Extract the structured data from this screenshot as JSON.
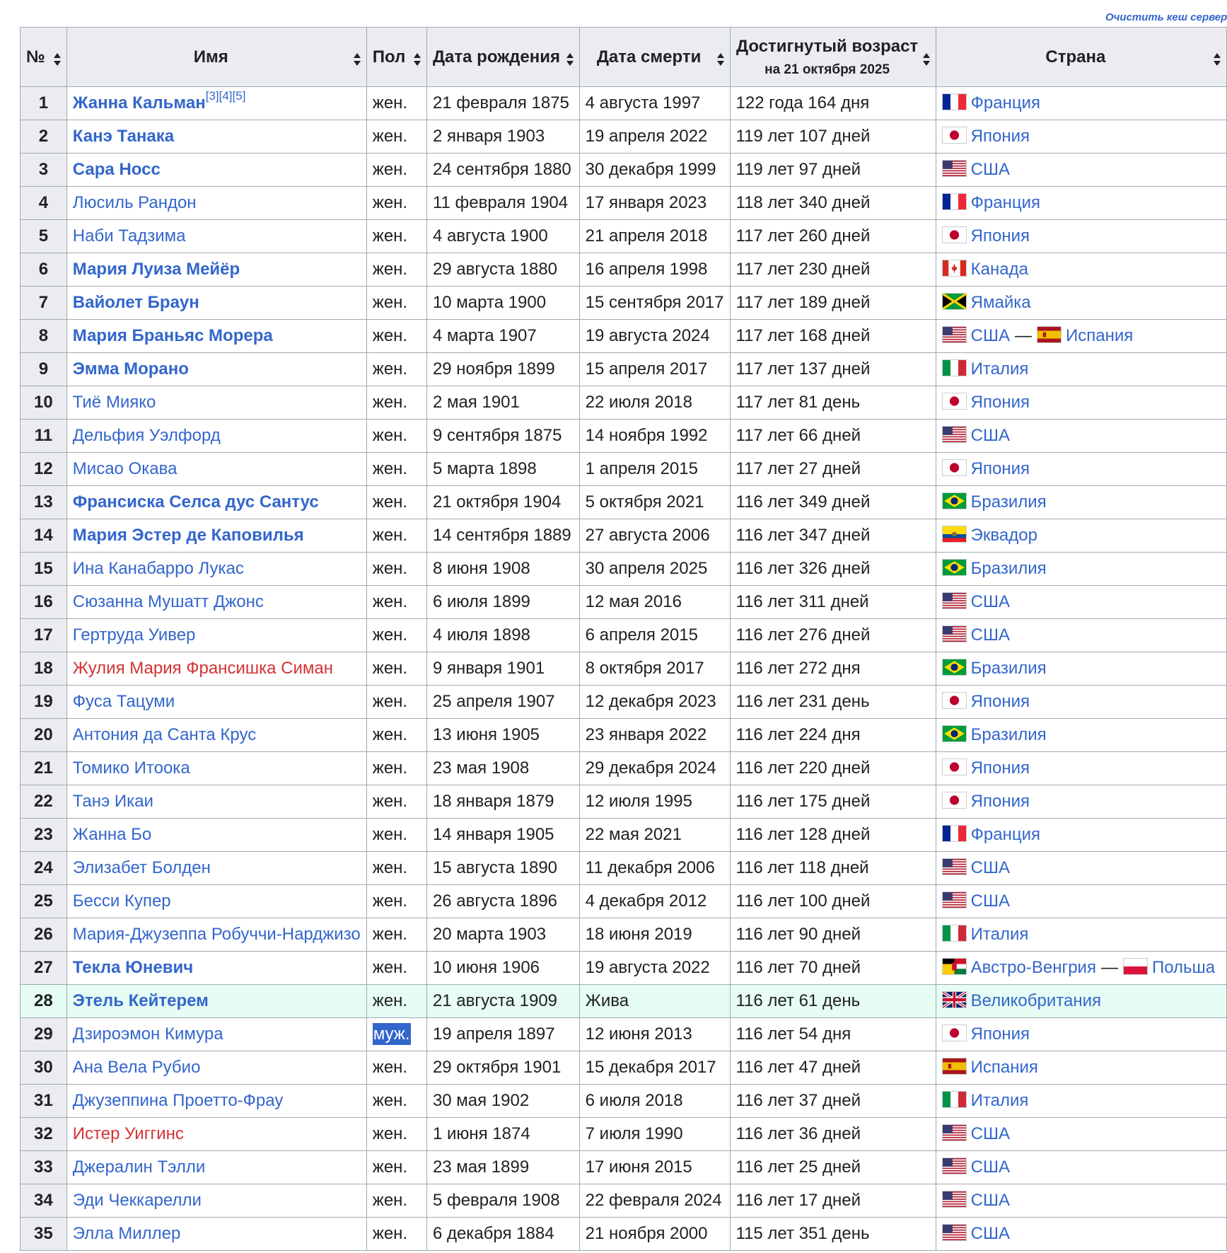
{
  "purge_link": "Очистить кеш сервера",
  "table": {
    "headers": {
      "num": "№",
      "name": "Имя",
      "sex": "Пол",
      "born": "Дата рождения",
      "died": "Дата смерти",
      "age": "Достигнутый возраст",
      "age_sub": "на 21 октября 2025",
      "country": "Страна"
    },
    "rows": [
      {
        "n": "1",
        "name": "Жанна Кальман",
        "refs": "[3][4][5]",
        "bold": true,
        "red": false,
        "sex": "жен.",
        "born": "21 февраля 1875",
        "died": "4 августа 1997",
        "age": "122 года 164 дня",
        "c": [
          {
            "flag": "fr",
            "name": "Франция"
          }
        ]
      },
      {
        "n": "2",
        "name": "Канэ Танака",
        "refs": "",
        "bold": true,
        "red": false,
        "sex": "жен.",
        "born": "2 января 1903",
        "died": "19 апреля 2022",
        "age": "119 лет 107 дней",
        "c": [
          {
            "flag": "jp",
            "name": "Япония"
          }
        ]
      },
      {
        "n": "3",
        "name": "Сара Носс",
        "refs": "",
        "bold": true,
        "red": false,
        "sex": "жен.",
        "born": "24 сентября 1880",
        "died": "30 декабря 1999",
        "age": "119 лет 97 дней",
        "c": [
          {
            "flag": "us",
            "name": "США"
          }
        ]
      },
      {
        "n": "4",
        "name": "Люсиль Рандон",
        "refs": "",
        "bold": false,
        "red": false,
        "sex": "жен.",
        "born": "11 февраля 1904",
        "died": "17 января 2023",
        "age": "118 лет 340 дней",
        "c": [
          {
            "flag": "fr",
            "name": "Франция"
          }
        ]
      },
      {
        "n": "5",
        "name": "Наби Тадзима",
        "refs": "",
        "bold": false,
        "red": false,
        "sex": "жен.",
        "born": "4 августа 1900",
        "died": "21 апреля 2018",
        "age": "117 лет 260 дней",
        "c": [
          {
            "flag": "jp",
            "name": "Япония"
          }
        ]
      },
      {
        "n": "6",
        "name": "Мария Луиза Мейёр",
        "refs": "",
        "bold": true,
        "red": false,
        "sex": "жен.",
        "born": "29 августа 1880",
        "died": "16 апреля 1998",
        "age": "117 лет 230 дней",
        "c": [
          {
            "flag": "ca",
            "name": "Канада"
          }
        ]
      },
      {
        "n": "7",
        "name": "Вайолет Браун",
        "refs": "",
        "bold": true,
        "red": false,
        "sex": "жен.",
        "born": "10 марта 1900",
        "died": "15 сентября 2017",
        "age": "117 лет 189 дней",
        "c": [
          {
            "flag": "jm",
            "name": "Ямайка"
          }
        ]
      },
      {
        "n": "8",
        "name": "Мария Браньяс Морера",
        "refs": "",
        "bold": true,
        "red": false,
        "sex": "жен.",
        "born": "4 марта 1907",
        "died": "19 августа 2024",
        "age": "117 лет 168 дней",
        "c": [
          {
            "flag": "us",
            "name": "США"
          },
          {
            "flag": "es",
            "name": "Испания"
          }
        ]
      },
      {
        "n": "9",
        "name": "Эмма Морано",
        "refs": "",
        "bold": true,
        "red": false,
        "sex": "жен.",
        "born": "29 ноября 1899",
        "died": "15 апреля 2017",
        "age": "117 лет 137 дней",
        "c": [
          {
            "flag": "it",
            "name": "Италия"
          }
        ]
      },
      {
        "n": "10",
        "name": "Тиё Мияко",
        "refs": "",
        "bold": false,
        "red": false,
        "sex": "жен.",
        "born": "2 мая 1901",
        "died": "22 июля 2018",
        "age": "117 лет 81 день",
        "c": [
          {
            "flag": "jp",
            "name": "Япония"
          }
        ]
      },
      {
        "n": "11",
        "name": "Дельфия Уэлфорд",
        "refs": "",
        "bold": false,
        "red": false,
        "sex": "жен.",
        "born": "9 сентября 1875",
        "died": "14 ноября 1992",
        "age": "117 лет 66 дней",
        "c": [
          {
            "flag": "us",
            "name": "США"
          }
        ]
      },
      {
        "n": "12",
        "name": "Мисао Окава",
        "refs": "",
        "bold": false,
        "red": false,
        "sex": "жен.",
        "born": "5 марта 1898",
        "died": "1 апреля 2015",
        "age": "117 лет 27 дней",
        "c": [
          {
            "flag": "jp",
            "name": "Япония"
          }
        ]
      },
      {
        "n": "13",
        "name": "Франсиска Селса дус Сантус",
        "refs": "",
        "bold": true,
        "red": false,
        "sex": "жен.",
        "born": "21 октября 1904",
        "died": "5 октября 2021",
        "age": "116 лет 349 дней",
        "c": [
          {
            "flag": "br",
            "name": "Бразилия"
          }
        ]
      },
      {
        "n": "14",
        "name": "Мария Эстер де Каповилья",
        "refs": "",
        "bold": true,
        "red": false,
        "sex": "жен.",
        "born": "14 сентября 1889",
        "died": "27 августа 2006",
        "age": "116 лет 347 дней",
        "c": [
          {
            "flag": "ec",
            "name": "Эквадор"
          }
        ]
      },
      {
        "n": "15",
        "name": "Ина Канабарро Лукас",
        "refs": "",
        "bold": false,
        "red": false,
        "sex": "жен.",
        "born": "8 июня 1908",
        "died": "30 апреля 2025",
        "age": "116 лет 326 дней",
        "c": [
          {
            "flag": "br",
            "name": "Бразилия"
          }
        ]
      },
      {
        "n": "16",
        "name": "Сюзанна Мушатт Джонс",
        "refs": "",
        "bold": false,
        "red": false,
        "sex": "жен.",
        "born": "6 июля 1899",
        "died": "12 мая 2016",
        "age": "116 лет 311 дней",
        "c": [
          {
            "flag": "us",
            "name": "США"
          }
        ]
      },
      {
        "n": "17",
        "name": "Гертруда Уивер",
        "refs": "",
        "bold": false,
        "red": false,
        "sex": "жен.",
        "born": "4 июля 1898",
        "died": "6 апреля 2015",
        "age": "116 лет 276 дней",
        "c": [
          {
            "flag": "us",
            "name": "США"
          }
        ]
      },
      {
        "n": "18",
        "name": "Жулия Мария Франсишка Симан",
        "refs": "",
        "bold": false,
        "red": true,
        "sex": "жен.",
        "born": "9 января 1901",
        "died": "8 октября 2017",
        "age": "116 лет 272 дня",
        "c": [
          {
            "flag": "br",
            "name": "Бразилия"
          }
        ]
      },
      {
        "n": "19",
        "name": "Фуса Тацуми",
        "refs": "",
        "bold": false,
        "red": false,
        "sex": "жен.",
        "born": "25 апреля 1907",
        "died": "12 декабря 2023",
        "age": "116 лет 231 день",
        "c": [
          {
            "flag": "jp",
            "name": "Япония"
          }
        ]
      },
      {
        "n": "20",
        "name": "Антония да Санта Крус",
        "refs": "",
        "bold": false,
        "red": false,
        "sex": "жен.",
        "born": "13 июня 1905",
        "died": "23 января 2022",
        "age": "116 лет 224 дня",
        "c": [
          {
            "flag": "br",
            "name": "Бразилия"
          }
        ]
      },
      {
        "n": "21",
        "name": "Томико Итоока",
        "refs": "",
        "bold": false,
        "red": false,
        "sex": "жен.",
        "born": "23 мая 1908",
        "died": "29 декабря 2024",
        "age": "116 лет 220 дней",
        "c": [
          {
            "flag": "jp",
            "name": "Япония"
          }
        ]
      },
      {
        "n": "22",
        "name": "Танэ Икаи",
        "refs": "",
        "bold": false,
        "red": false,
        "sex": "жен.",
        "born": "18 января 1879",
        "died": "12 июля 1995",
        "age": "116 лет 175 дней",
        "c": [
          {
            "flag": "jp",
            "name": "Япония"
          }
        ]
      },
      {
        "n": "23",
        "name": "Жанна Бо",
        "refs": "",
        "bold": false,
        "red": false,
        "sex": "жен.",
        "born": "14 января 1905",
        "died": "22 мая 2021",
        "age": "116 лет 128 дней",
        "c": [
          {
            "flag": "fr",
            "name": "Франция"
          }
        ]
      },
      {
        "n": "24",
        "name": "Элизабет Болден",
        "refs": "",
        "bold": false,
        "red": false,
        "sex": "жен.",
        "born": "15 августа 1890",
        "died": "11 декабря 2006",
        "age": "116 лет 118 дней",
        "c": [
          {
            "flag": "us",
            "name": "США"
          }
        ]
      },
      {
        "n": "25",
        "name": "Бесси Купер",
        "refs": "",
        "bold": false,
        "red": false,
        "sex": "жен.",
        "born": "26 августа 1896",
        "died": "4 декабря 2012",
        "age": "116 лет 100 дней",
        "c": [
          {
            "flag": "us",
            "name": "США"
          }
        ]
      },
      {
        "n": "26",
        "name": "Мария-Джузеппа Робуччи-Нарджизо",
        "refs": "",
        "bold": false,
        "red": false,
        "sex": "жен.",
        "born": "20 марта 1903",
        "died": "18 июня 2019",
        "age": "116 лет 90 дней",
        "c": [
          {
            "flag": "it",
            "name": "Италия"
          }
        ]
      },
      {
        "n": "27",
        "name": "Текла Юневич",
        "refs": "",
        "bold": true,
        "red": false,
        "sex": "жен.",
        "born": "10 июня 1906",
        "died": "19 августа 2022",
        "age": "116 лет 70 дней",
        "c": [
          {
            "flag": "ah",
            "name": "Австро-Венгрия"
          },
          {
            "flag": "pl",
            "name": "Польша"
          }
        ]
      },
      {
        "n": "28",
        "name": "Этель Кейтерем",
        "refs": "",
        "bold": true,
        "red": false,
        "alive": true,
        "sex": "жен.",
        "born": "21 августа 1909",
        "died": "Жива",
        "age": "116 лет 61 день",
        "c": [
          {
            "flag": "gb",
            "name": "Великобритания"
          }
        ]
      },
      {
        "n": "29",
        "name": "Дзироэмон Кимура",
        "refs": "",
        "bold": false,
        "red": false,
        "sex": "муж.",
        "born": "19 апреля 1897",
        "died": "12 июня 2013",
        "age": "116 лет 54 дня",
        "c": [
          {
            "flag": "jp",
            "name": "Япония"
          }
        ]
      },
      {
        "n": "30",
        "name": "Ана Вела Рубио",
        "refs": "",
        "bold": false,
        "red": false,
        "sex": "жен.",
        "born": "29 октября 1901",
        "died": "15 декабря 2017",
        "age": "116 лет 47 дней",
        "c": [
          {
            "flag": "es",
            "name": "Испания"
          }
        ]
      },
      {
        "n": "31",
        "name": "Джузеппина Проетто-Фрау",
        "refs": "",
        "bold": false,
        "red": false,
        "sex": "жен.",
        "born": "30 мая 1902",
        "died": "6 июля 2018",
        "age": "116 лет 37 дней",
        "c": [
          {
            "flag": "it",
            "name": "Италия"
          }
        ]
      },
      {
        "n": "32",
        "name": "Истер Уиггинс",
        "refs": "",
        "bold": false,
        "red": true,
        "sex": "жен.",
        "born": "1 июня 1874",
        "died": "7 июля 1990",
        "age": "116 лет 36 дней",
        "c": [
          {
            "flag": "us",
            "name": "США"
          }
        ]
      },
      {
        "n": "33",
        "name": "Джералин Тэлли",
        "refs": "",
        "bold": false,
        "red": false,
        "sex": "жен.",
        "born": "23 мая 1899",
        "died": "17 июня 2015",
        "age": "116 лет 25 дней",
        "c": [
          {
            "flag": "us",
            "name": "США"
          }
        ]
      },
      {
        "n": "34",
        "name": "Эди Чеккарелли",
        "refs": "",
        "bold": false,
        "red": false,
        "sex": "жен.",
        "born": "5 февраля 1908",
        "died": "22 февраля 2024",
        "age": "116 лет 17 дней",
        "c": [
          {
            "flag": "us",
            "name": "США"
          }
        ]
      },
      {
        "n": "35",
        "name": "Элла Миллер",
        "refs": "",
        "bold": false,
        "red": false,
        "sex": "жен.",
        "born": "6 декабря 1884",
        "died": "21 ноября 2000",
        "age": "115 лет 351 день",
        "c": [
          {
            "flag": "us",
            "name": "США"
          }
        ]
      }
    ],
    "colors": {
      "link": "#3366cc",
      "redlink": "#d33333",
      "header_bg": "#eaecf0",
      "border": "#a2a9b1",
      "alive_bg": "#e6fcf4",
      "selection_bg": "#3366cc"
    }
  }
}
